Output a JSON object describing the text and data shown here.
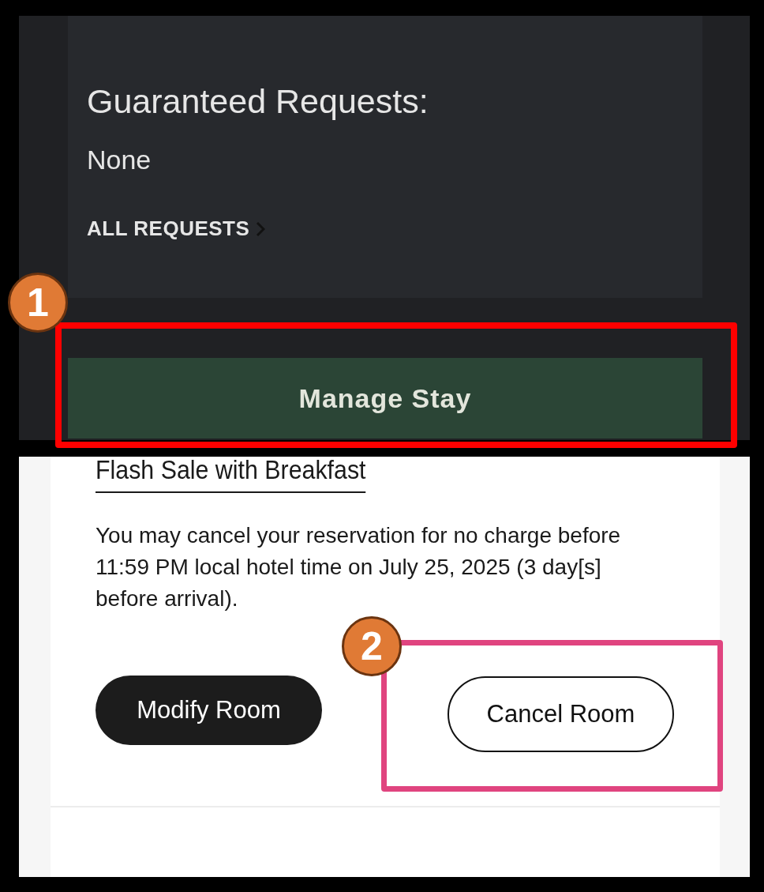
{
  "requests_card": {
    "heading": "Guaranteed Requests:",
    "value": "None",
    "link": "ALL REQUESTS"
  },
  "manage_button": {
    "label": "Manage Stay"
  },
  "rate": {
    "name": "Flash Sale with Breakfast",
    "policy": "You may cancel your reservation for no charge before 11:59 PM local hotel time on July 25, 2025 (3 day[s] before arrival)."
  },
  "actions": [
    {
      "kind": "filled",
      "label": "Modify Room"
    },
    {
      "kind": "outlined",
      "label": "Cancel Room"
    }
  ],
  "annotations": [
    {
      "number": "1",
      "color": "#ff0000"
    },
    {
      "number": "2",
      "color": "#e0447f"
    }
  ]
}
